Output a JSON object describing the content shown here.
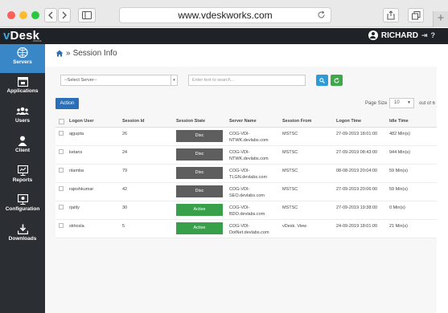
{
  "browser": {
    "url": "www.vdeskworks.com",
    "new_tab": "+"
  },
  "app": {
    "logo_v": "v",
    "logo_rest": "Desk",
    "logo_sub": "works",
    "user_name": "RICHARD"
  },
  "sidebar": {
    "items": [
      {
        "label": "Servers",
        "icon": "servers-icon"
      },
      {
        "label": "Applications",
        "icon": "applications-icon"
      },
      {
        "label": "Users",
        "icon": "users-icon"
      },
      {
        "label": "Client",
        "icon": "client-icon"
      },
      {
        "label": "Reports",
        "icon": "reports-icon"
      },
      {
        "label": "Configuration",
        "icon": "configuration-icon"
      },
      {
        "label": "Downloads",
        "icon": "downloads-icon"
      }
    ]
  },
  "page": {
    "breadcrumb_sep": "»",
    "title": "Session Info"
  },
  "filters": {
    "server_select": "--Select Server--",
    "search_placeholder": "Enter text to search..."
  },
  "toolbar": {
    "action_label": "Action",
    "page_size_label": "Page Size",
    "page_size_value": "10",
    "out_of_label": "out of 6"
  },
  "table": {
    "headers": [
      "Logon User",
      "Session Id",
      "Session State",
      "Server Name",
      "Session From",
      "Logon Time",
      "Idle Time"
    ],
    "rows": [
      {
        "user": "ajgupta",
        "id": "26",
        "state": "Disc",
        "server": "COG-VDI-NTWK.devlabs.com",
        "from": "MSTSC",
        "logon": "27-09-2019 18:01:00",
        "idle": "482 Min(s)"
      },
      {
        "user": "ketans",
        "id": "24",
        "state": "Disc",
        "server": "COG-VDI-NTWK.devlabs.com",
        "from": "MSTSC",
        "logon": "27-09-2019 08:43:00",
        "idle": "944 Min(s)"
      },
      {
        "user": "nlamba",
        "id": "79",
        "state": "Disc",
        "server": "COG-VDI-TLGN.devlabs.com",
        "from": "MSTSC",
        "logon": "08-08-2019 20:04:00",
        "idle": "59 Min(s)"
      },
      {
        "user": "rajeshkumar",
        "id": "42",
        "state": "Disc",
        "server": "COG-VDI-SEO.devlabs.com",
        "from": "MSTSC",
        "logon": "27-09-2019 20:06:00",
        "idle": "59 Min(s)"
      },
      {
        "user": "rjaitly",
        "id": "30",
        "state": "Active",
        "server": "COG-VDI-BDO.devlabs.com",
        "from": "MSTSC",
        "logon": "27-09-2019 19:38:00",
        "idle": "0 Min(s)"
      },
      {
        "user": "skhosla",
        "id": "5",
        "state": "Active",
        "server": "COG-VDI-DotNet.devlabs.com",
        "from": "vDesk. View",
        "logon": "24-09-2019 18:01:00",
        "idle": "21 Min(s)"
      }
    ]
  },
  "colors": {
    "accent": "#3a87c8",
    "sidebar_bg": "#2b2e33",
    "header_bg": "#1f2226",
    "disc_state": "#5e5e5e",
    "active_state": "#38a04a"
  }
}
